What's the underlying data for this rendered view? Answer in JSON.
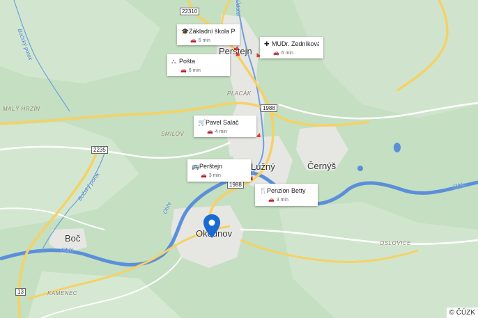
{
  "map": {
    "towns": {
      "perstejn": "Perštejn",
      "luzny": "Lužný",
      "cernys": "Černýš",
      "okounov": "Okounov",
      "boc": "Boč"
    },
    "localities": {
      "maly_hrzin": "MALÝ HRZÍN",
      "placak": "PLACÁK",
      "smilov": "SMILOV",
      "kamenec": "KAMENEC",
      "okolovice": "OSLOVICE"
    },
    "streams": {
      "bocsky_left": "Bočský potok",
      "bocsky_mid": "Bočský potok",
      "ohre_left": "Ohře",
      "ohre_bottom": "Ohře",
      "ohre_right": "Ohře",
      "udolni": "Údolní"
    },
    "roads": {
      "r22310": "22310",
      "r1988_top": "1988",
      "r2235": "2235",
      "r1988_mid": "1988",
      "r13": "13"
    },
    "pois": [
      {
        "name": "Základní škola Pe…",
        "time": "6 min",
        "icon": "school-icon"
      },
      {
        "name": "MUDr. Zedníková …",
        "time": "6 min",
        "icon": "medical-icon"
      },
      {
        "name": "Pošta",
        "time": "6 min",
        "icon": "post-office-icon"
      },
      {
        "name": "Pavel Salač",
        "time": "4 min",
        "icon": "shop-cart-icon"
      },
      {
        "name": "Perštejn",
        "time": "3 min",
        "icon": "bus-icon"
      },
      {
        "name": "Penzion Betty",
        "time": "3 min",
        "icon": "restaurant-icon"
      }
    ],
    "copyright": "© ČÚZK",
    "colors": {
      "land": "#c4dfc1",
      "urban": "#e6e6e3",
      "river": "#5b8fda",
      "road_major": "#f5d166",
      "pin": "#1a6ad2"
    }
  }
}
